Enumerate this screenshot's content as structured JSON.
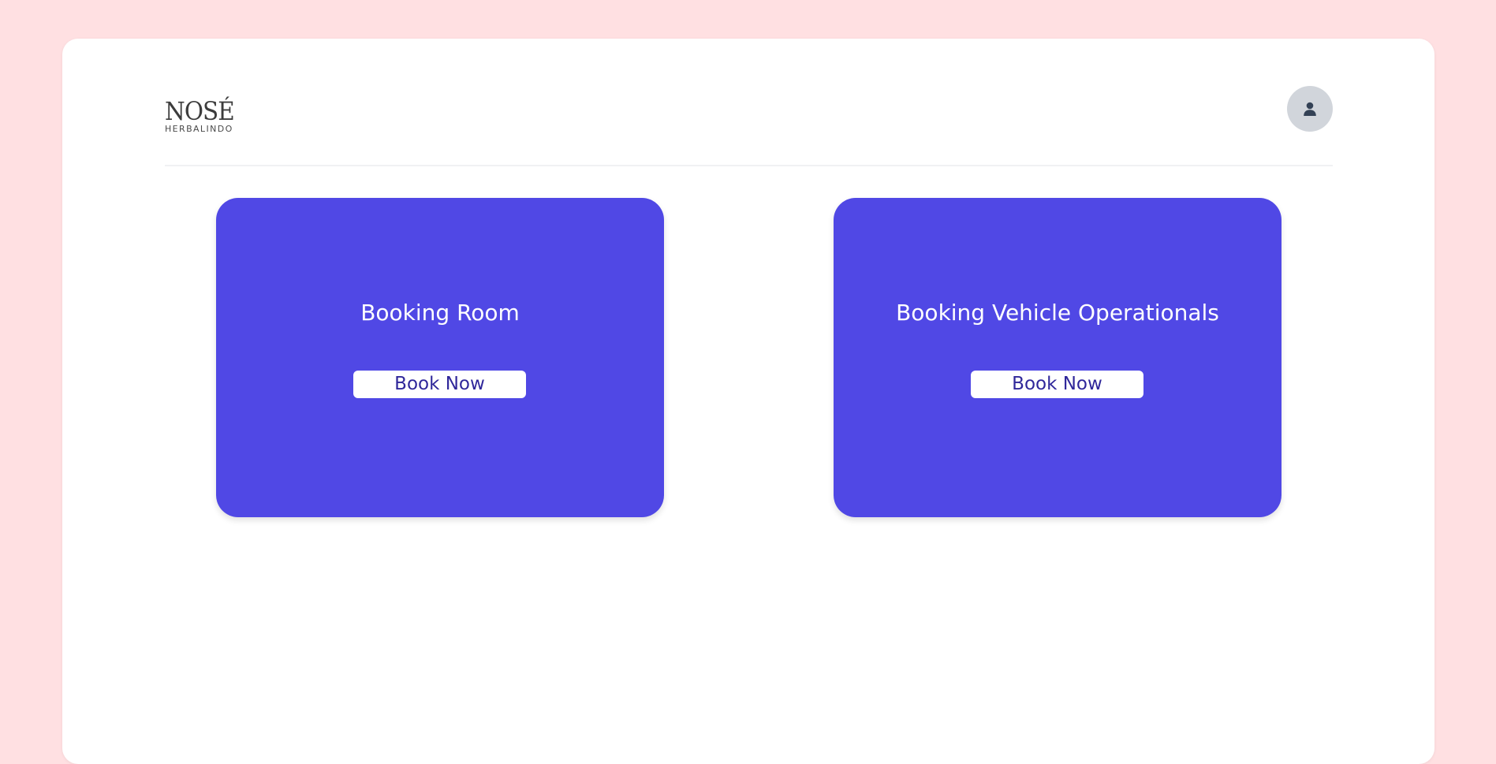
{
  "brand": {
    "name": "NOSÉ",
    "tagline": "HERBALINDO"
  },
  "header": {
    "user_icon": "user-icon"
  },
  "cards": [
    {
      "title": "Booking Room",
      "button_label": "Book Now"
    },
    {
      "title": "Booking Vehicle Operationals",
      "button_label": "Book Now"
    }
  ],
  "colors": {
    "page_background": "#ffe0e2",
    "panel_background": "#ffffff",
    "card_background": "#5048e5",
    "button_text": "#2f279a",
    "avatar_background": "#d1d5db",
    "avatar_icon": "#334155"
  }
}
